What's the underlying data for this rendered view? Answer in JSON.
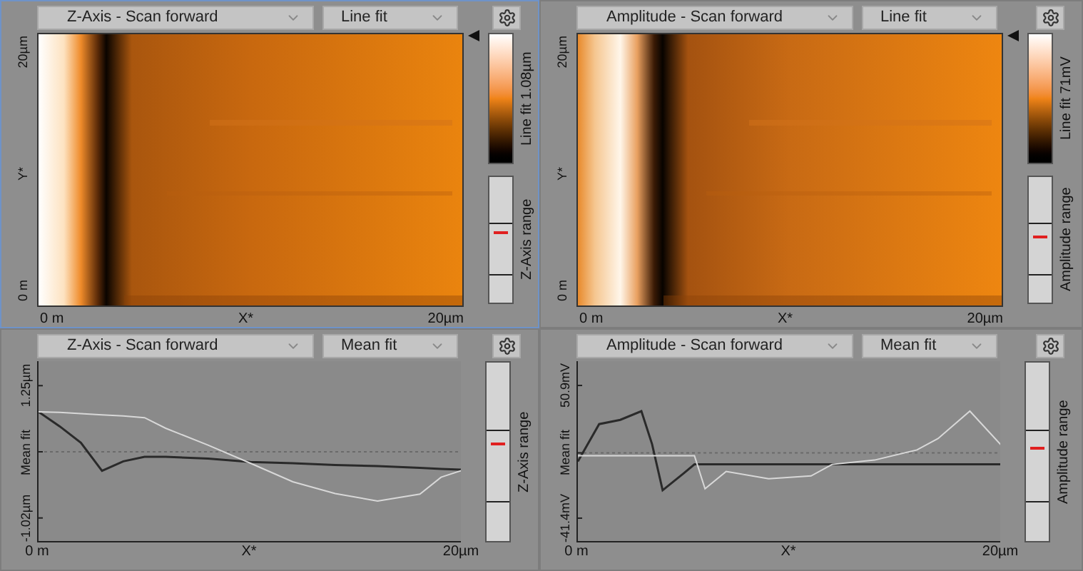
{
  "panels": [
    {
      "selected": true,
      "channel": "Z-Axis - Scan forward",
      "fit": "Line fit",
      "y_axis": [
        "20µm",
        "Y*",
        "0 m"
      ],
      "x_axis": [
        "0 m",
        "X*",
        "20µm"
      ],
      "colorbar_label": "Line fit 1.08µm",
      "range": {
        "label": "Z-Axis range",
        "level": 0.54
      }
    },
    {
      "selected": false,
      "channel": "Amplitude - Scan forward",
      "fit": "Line fit",
      "y_axis": [
        "20µm",
        "Y*",
        "0 m"
      ],
      "x_axis": [
        "0 m",
        "X*",
        "20µm"
      ],
      "colorbar_label": "Line fit 71mV",
      "range": {
        "label": "Amplitude range",
        "level": 0.51
      }
    },
    {
      "kind": "profile",
      "selected": false,
      "channel": "Z-Axis - Scan forward",
      "fit": "Mean fit",
      "range": {
        "label": "Z-Axis range",
        "level": 0.54
      },
      "chart_data": {
        "type": "line",
        "x": [
          0,
          1,
          2,
          3,
          4,
          5,
          6,
          8,
          10,
          12,
          14,
          16,
          18,
          19,
          20
        ],
        "series": [
          {
            "color": "#2a2a2a",
            "values": [
              0.8,
              0.55,
              0.27,
              -0.21,
              -0.05,
              0.03,
              0.03,
              0.0,
              -0.06,
              -0.08,
              -0.11,
              -0.13,
              -0.16,
              -0.18,
              -0.19
            ]
          },
          {
            "color": "#d8d8d8",
            "values": [
              0.8,
              0.79,
              0.77,
              0.75,
              0.73,
              0.7,
              0.52,
              0.23,
              -0.08,
              -0.4,
              -0.6,
              -0.73,
              -0.61,
              -0.32,
              -0.2
            ]
          }
        ],
        "xlim": [
          0,
          20
        ],
        "ylim": [
          -1.44,
          1.67
        ],
        "xticks": [
          {
            "value": 0,
            "label": "0 m"
          },
          {
            "value": 10,
            "label": "X*"
          },
          {
            "value": 20,
            "label": "20µm"
          }
        ],
        "yticks": [
          {
            "value": 1.25,
            "label": "1.25µm"
          },
          {
            "value": 0.115,
            "label": "Mean fit"
          },
          {
            "value": -1.02,
            "label": "-1.02µm"
          }
        ]
      }
    },
    {
      "kind": "profile",
      "selected": false,
      "channel": "Amplitude - Scan forward",
      "fit": "Mean fit",
      "range": {
        "label": "Amplitude range",
        "level": 0.51
      },
      "chart_data": {
        "type": "line",
        "x": [
          0,
          0.5,
          1,
          2,
          3,
          3.5,
          4,
          5,
          5.5,
          6,
          7,
          9,
          11,
          12,
          14,
          16,
          17,
          18.5,
          20
        ],
        "series": [
          {
            "color": "#2a2a2a",
            "values": [
              -2,
              11,
              24,
              27,
              33,
              10,
              -22,
              -10,
              -4,
              -4,
              -4,
              -4,
              -4,
              -4,
              -4,
              -4,
              -4,
              -4,
              -4
            ]
          },
          {
            "color": "#d8d8d8",
            "values": [
              2,
              2,
              2,
              2,
              2,
              2,
              2,
              2,
              2,
              -21,
              -9,
              -14,
              -12,
              -4,
              -1,
              6,
              14,
              33,
              9
            ]
          }
        ],
        "xlim": [
          0,
          20
        ],
        "ylim": [
          -58.3,
          67.8
        ],
        "xticks": [
          {
            "value": 0,
            "label": "0 m"
          },
          {
            "value": 10,
            "label": "X*"
          },
          {
            "value": 20,
            "label": "20µm"
          }
        ],
        "yticks": [
          {
            "value": 50.9,
            "label": "50.9mV"
          },
          {
            "value": 4,
            "label": "Mean fit"
          },
          {
            "value": -41.4,
            "label": "-41.4mV"
          }
        ]
      }
    }
  ]
}
